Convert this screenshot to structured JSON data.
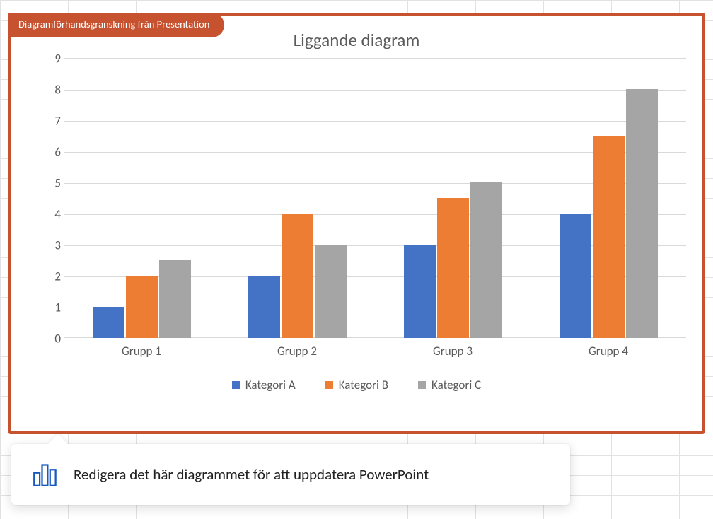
{
  "preview_badge": "Diagramförhandsgranskning från Presentation",
  "chart_data": {
    "type": "bar",
    "title": "Liggande diagram",
    "categories": [
      "Grupp 1",
      "Grupp 2",
      "Grupp 3",
      "Grupp 4"
    ],
    "series": [
      {
        "name": "Kategori A",
        "values": [
          1,
          2,
          3,
          4
        ],
        "color": "#4472c4"
      },
      {
        "name": "Kategori B",
        "values": [
          2,
          4,
          4.5,
          6.5
        ],
        "color": "#ec7d32"
      },
      {
        "name": "Kategori C",
        "values": [
          2.5,
          3,
          5,
          8
        ],
        "color": "#a5a5a5"
      }
    ],
    "ylim": [
      0,
      9
    ],
    "yticks": [
      0,
      1,
      2,
      3,
      4,
      5,
      6,
      7,
      8,
      9
    ],
    "xlabel": "",
    "ylabel": ""
  },
  "callout_text": "Redigera det här diagrammet för att uppdatera PowerPoint"
}
